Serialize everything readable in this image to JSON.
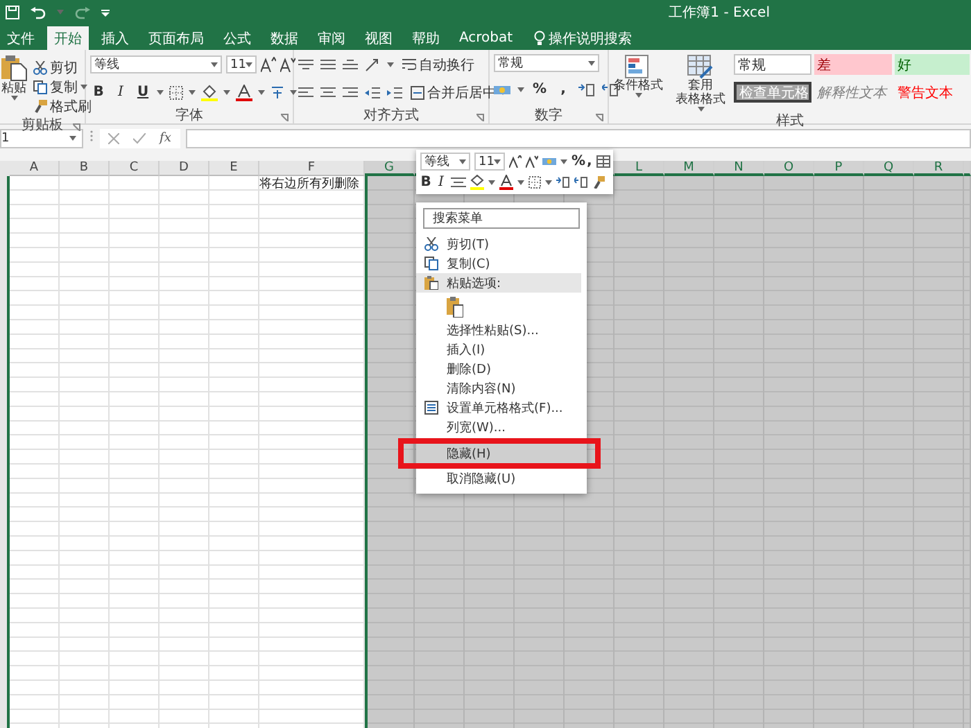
{
  "title_bar": {
    "title": "工作簿1 - Excel"
  },
  "tabs": [
    {
      "label": "文件",
      "selected": false
    },
    {
      "label": "开始",
      "selected": true
    },
    {
      "label": "插入",
      "selected": false
    },
    {
      "label": "页面布局",
      "selected": false
    },
    {
      "label": "公式",
      "selected": false
    },
    {
      "label": "数据",
      "selected": false
    },
    {
      "label": "审阅",
      "selected": false
    },
    {
      "label": "视图",
      "selected": false
    },
    {
      "label": "帮助",
      "selected": false
    },
    {
      "label": "Acrobat",
      "selected": false
    }
  ],
  "tell_me": "操作说明搜索",
  "ribbon": {
    "clipboard": {
      "paste": "粘贴",
      "cut": "剪切",
      "copy": "复制",
      "format_painter": "格式刷",
      "label": "剪贴板"
    },
    "font": {
      "name": "等线",
      "size": "11",
      "bold": "B",
      "italic": "I",
      "underline": "U",
      "label": "字体"
    },
    "alignment": {
      "wrap": "自动换行",
      "merge": "合并后居中",
      "label": "对齐方式"
    },
    "number": {
      "format": "常规",
      "percent": "%",
      "comma": ",",
      "label": "数字"
    },
    "styles": {
      "conditional": "条件格式",
      "table_lines": [
        "套用",
        "表格格式"
      ],
      "label": "样式",
      "cells": [
        {
          "label": "常规",
          "kind": "normal"
        },
        {
          "label": "差",
          "kind": "bad"
        },
        {
          "label": "好",
          "kind": "good"
        },
        {
          "label": "检查单元格",
          "kind": "check"
        },
        {
          "label": "解释性文本",
          "kind": "explanatory"
        },
        {
          "label": "警告文本",
          "kind": "warning"
        }
      ]
    }
  },
  "formula_bar": {
    "name_box": "1",
    "fx": "fx"
  },
  "sheet": {
    "columns": [
      {
        "label": "A",
        "selected": false
      },
      {
        "label": "B",
        "selected": false
      },
      {
        "label": "C",
        "selected": false
      },
      {
        "label": "D",
        "selected": false
      },
      {
        "label": "E",
        "selected": false
      },
      {
        "label": "F",
        "selected": false,
        "cells": [
          "将右边所有列删除"
        ]
      },
      {
        "label": "G",
        "selected": true
      },
      {
        "selected": true
      },
      {
        "selected": true
      },
      {
        "selected": true
      },
      {
        "selected": true
      },
      {
        "label": "L",
        "selected": true
      },
      {
        "label": "M",
        "selected": true
      },
      {
        "label": "N",
        "selected": true
      },
      {
        "label": "O",
        "selected": true
      },
      {
        "label": "P",
        "selected": true
      },
      {
        "label": "Q",
        "selected": true
      },
      {
        "label": "R",
        "selected": true
      }
    ],
    "grid": true
  },
  "mini_toolbar": {
    "font": "等线",
    "size": "11",
    "percent": "%",
    "comma": ",",
    "bold": "B",
    "italic": "I"
  },
  "context_menu": {
    "search_placeholder": "搜索菜单",
    "items": [
      {
        "kind": "item",
        "label": "剪切(T)",
        "selected": false
      },
      {
        "kind": "item",
        "label": "复制(C)",
        "selected": false
      },
      {
        "kind": "header",
        "label": "粘贴选项:",
        "selected": false
      },
      {
        "kind": "paste-option",
        "selected": false
      },
      {
        "kind": "item",
        "label": "选择性粘贴(S)...",
        "selected": false
      },
      {
        "kind": "item",
        "label": "插入(I)",
        "selected": false
      },
      {
        "kind": "item",
        "label": "删除(D)",
        "selected": false
      },
      {
        "kind": "item",
        "label": "清除内容(N)",
        "selected": false
      },
      {
        "kind": "item",
        "label": "设置单元格格式(F)...",
        "selected": false
      },
      {
        "kind": "item",
        "label": "列宽(W)...",
        "selected": false
      },
      {
        "kind": "item",
        "label": "隐藏(H)",
        "selected": true,
        "annotated": true
      },
      {
        "kind": "item",
        "label": "取消隐藏(U)",
        "selected": false
      }
    ]
  }
}
